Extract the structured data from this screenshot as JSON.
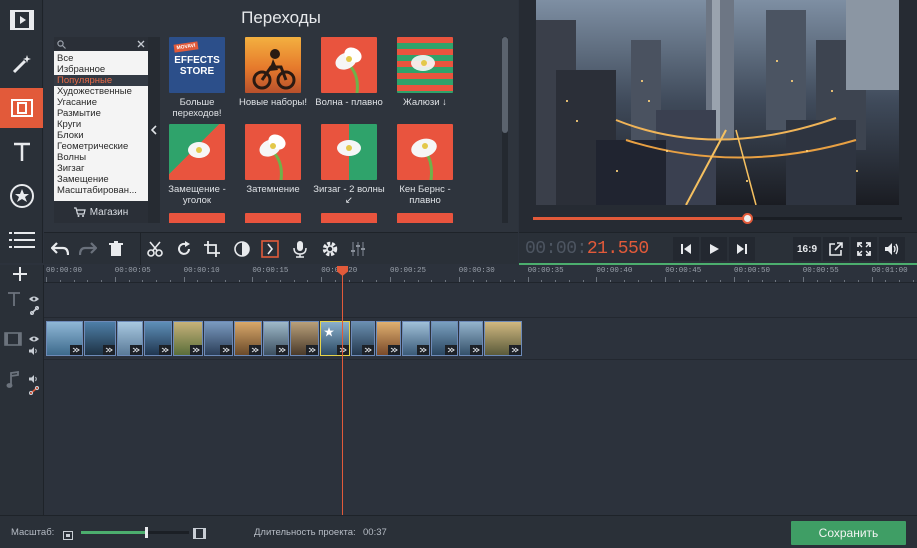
{
  "panel": {
    "title": "Переходы",
    "categories": [
      "Все",
      "Избранное",
      "Популярные",
      "Художественные",
      "Угасание",
      "Размытие",
      "Круги",
      "Блоки",
      "Геометрические",
      "Волны",
      "Зигзаг",
      "Замещение",
      "Масштабирован..."
    ],
    "selected_category": "Популярные",
    "store_label": "Магазин",
    "thumbnails": [
      {
        "label": "Больше переходов!",
        "badge_line1": "MOVAVI",
        "badge_line2": "EFFECTS",
        "badge_line3": "STORE"
      },
      {
        "label": "Новые наборы!"
      },
      {
        "label": "Волна - плавно"
      },
      {
        "label": "Жалюзи ↓"
      },
      {
        "label": "Замещение - уголок"
      },
      {
        "label": "Затемнение"
      },
      {
        "label": "Зигзаг - 2 волны ↙"
      },
      {
        "label": "Кен Бернс - плавно"
      }
    ]
  },
  "player": {
    "timecode_dim": "00:00:",
    "timecode_live": "21.550",
    "progress": 0.58,
    "aspect_label": "16:9"
  },
  "timeline": {
    "ticks": [
      "00:00:00",
      "00:00:05",
      "00:00:10",
      "00:00:15",
      "00:00:20",
      "00:00:25",
      "00:00:30",
      "00:00:35",
      "00:00:40",
      "00:00:45",
      "00:00:50",
      "00:00:55",
      "00:01:00"
    ]
  },
  "status": {
    "zoom_label": "Масштаб:",
    "zoom_level": 0.6,
    "duration_label": "Длительность проекта:",
    "duration_value": "00:37",
    "save_label": "Сохранить"
  },
  "colors": {
    "accent": "#e25a3a",
    "green": "#3f9e65"
  }
}
